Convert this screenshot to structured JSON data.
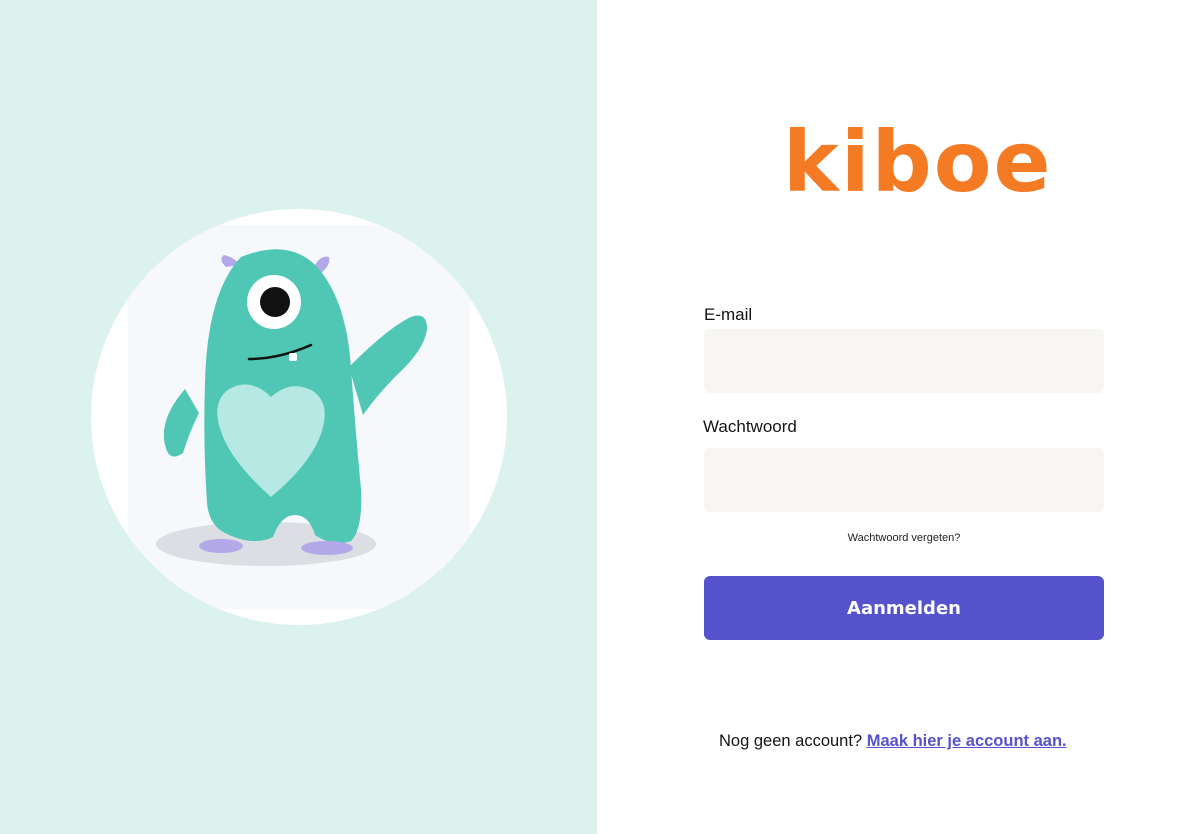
{
  "brand": {
    "logo_text": "kiboe",
    "logo_color": "#f47a24"
  },
  "illustration": {
    "name": "mascot-monster-waving",
    "body_color": "#4fc7b4",
    "heart_color": "#b6e9e4",
    "panel_color": "#dcf2ef"
  },
  "form": {
    "email_label": "E-mail",
    "email_value": "",
    "password_label": "Wachtwoord",
    "password_value": "",
    "forgot_link": "Wachtwoord vergeten?",
    "submit_label": "Aanmelden",
    "submit_color": "#5552cc"
  },
  "signup": {
    "prompt": "Nog geen account?",
    "link": "Maak hier je account aan."
  }
}
